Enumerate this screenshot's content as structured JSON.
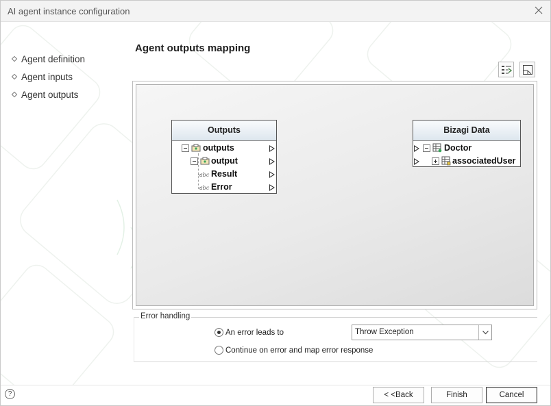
{
  "window": {
    "title": "AI agent instance configuration",
    "close_icon": "close-icon"
  },
  "nav": {
    "items": [
      {
        "label": "Agent definition"
      },
      {
        "label": "Agent inputs"
      },
      {
        "label": "Agent outputs"
      }
    ]
  },
  "main": {
    "heading": "Agent outputs mapping",
    "toolbar": {
      "auto_map_icon": "auto-map-icon",
      "layout_icon": "layout-icon"
    },
    "outputs_box": {
      "title": "Outputs",
      "rows": [
        {
          "label": "outputs"
        },
        {
          "label": "output"
        },
        {
          "label": "Result",
          "icon": "abc"
        },
        {
          "label": "Error",
          "icon": "abc"
        }
      ]
    },
    "bizagi_box": {
      "title": "Bizagi Data",
      "rows": [
        {
          "label": "Doctor"
        },
        {
          "label": "associatedUser"
        }
      ]
    }
  },
  "error_handling": {
    "legend": "Error handling",
    "option_1": "An error leads to",
    "option_2": "Continue on error and map error response",
    "selected_option": "An error leads to",
    "select_value": "Throw Exception"
  },
  "footer": {
    "help": "?",
    "back_label": "< <Back",
    "finish_label": "Finish",
    "cancel_label": "Cancel"
  }
}
